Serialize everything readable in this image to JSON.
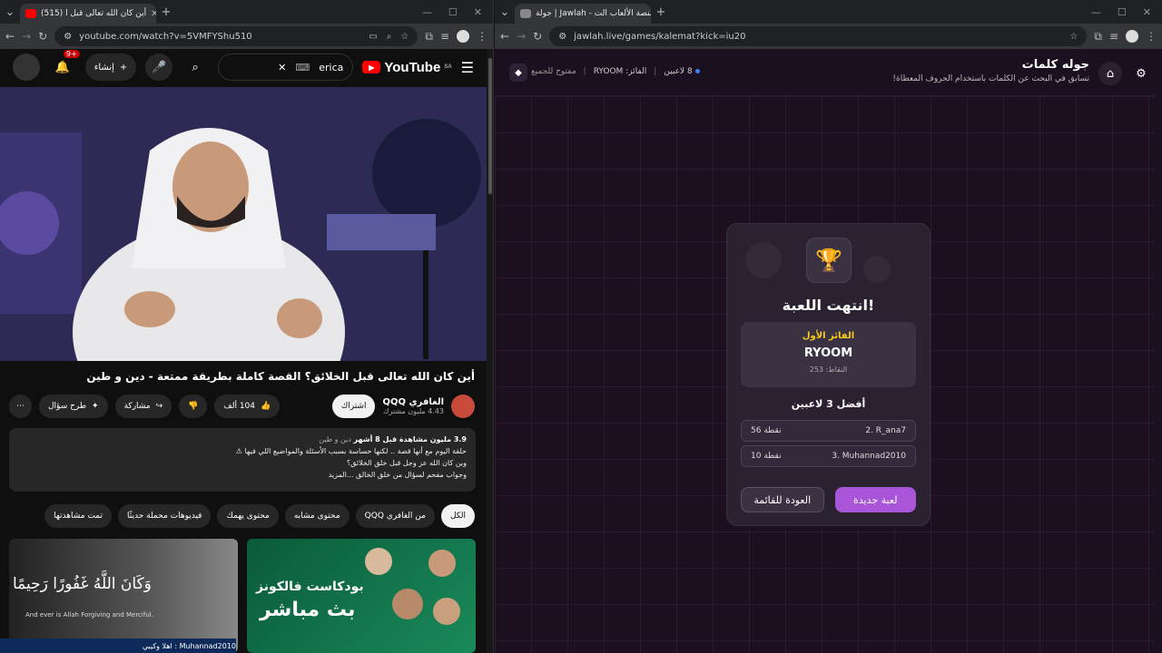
{
  "left_window": {
    "tab_title": "(515) أين كان الله تعالى قبل ا",
    "url": "youtube.com/watch?v=5VMFYShu510",
    "youtube": {
      "logo": "YouTube",
      "logo_region": "SA",
      "search_value": "erica",
      "create_label": "إنشاء",
      "notif_badge": "9+",
      "video_title": "أين كان الله تعالى قبل الخلائق؟ القصة كاملة بطريقة ممتعة - دين و طين",
      "channel_name": "الغافري QQQ",
      "subscribers": "4.43 مليون مشترك",
      "subscribe_label": "اشتراك",
      "likes": "104 ألف",
      "share_label": "مشاركة",
      "ask_label": "طرح سؤال",
      "desc_line1_bold": "3.9 مليون مشاهدة  قبل 8 أشهر",
      "desc_line1_tags": "دين و طين",
      "desc_line2": "حلقة اليوم مع أنها قصة .. لكنها حساسة بسبب الأسئلة والمواضيع اللي فيها ⚠",
      "desc_line3": "وين كان الله عز وجل قبل خلق الخلائق؟",
      "desc_line4": "وجواب مفحم لسؤال من خلق الخالق",
      "desc_more": "...المزيد",
      "filters": [
        "الكل",
        "من الغافري QQQ",
        "محتوى مشابه",
        "محتوى يهمك",
        "فيديوهات محملة حديثًا",
        "تمت مشاهدتها"
      ],
      "thumb1_text": "وَكَانَ اللَّهُ غَفُورًا رَحِيمًا",
      "thumb1_caption": "And ever is Allah Forgiving and Merciful.",
      "thumb2_text": "بودكاست فالكونز",
      "thumb2_text2": "بث مباشر",
      "status_text": "Muhannad2010 : اهلا وكيبي"
    }
  },
  "right_window": {
    "tab_title": "جولة | Jawlah - منصة الألعاب الت",
    "url": "jawlah.live/games/kalemat?kick=iu20",
    "header": {
      "title": "جوله كلمات",
      "subtitle": "تسابق في البحث عن الكلمات باستخدام الحروف المعطاة!",
      "players": "8 لاعبين",
      "winner_label": "الفائز: RYOOM",
      "open_label": "مفتوح للجميع"
    },
    "card": {
      "game_over": "انتهت اللعبة!",
      "first_winner_label": "الفائز الأول",
      "first_winner_name": "RYOOM",
      "first_winner_points": "النقاط: 253",
      "top3_title": "أفضل 3 لاعبين",
      "rows": [
        {
          "rank_name": "2. R_ana7",
          "points": "56 نقطة"
        },
        {
          "rank_name": "3. Muhannad2010",
          "points": "10 نقطة"
        }
      ],
      "back_button": "العودة للقائمة",
      "new_game_button": "لعبة جديدة"
    }
  }
}
